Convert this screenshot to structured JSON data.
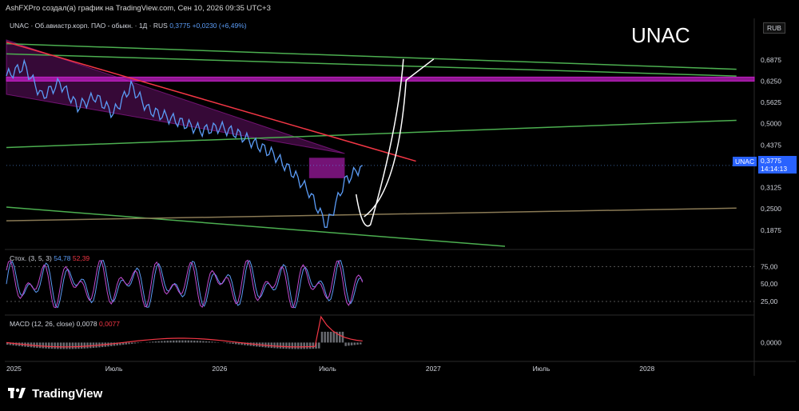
{
  "header": {
    "author_line": "AshFXPro создал(а) график на TradingView.com, Сен 10, 2026 09:35 UTC+3"
  },
  "legend": {
    "symbol_desc": "UNAC · Об.авиастр.корп. ПАО - обыкн. · 1Д · RUS",
    "last_value": "0,3775",
    "change": "+0,0230 (+6,49%)"
  },
  "big_ticker": "UNAC",
  "currency": "RUB",
  "price_tag": {
    "ticker": "UNAC",
    "value": "0,3775",
    "countdown": "14:14:13"
  },
  "stoch": {
    "label": "Стох. (3, 5, 3)",
    "k": "54,78",
    "d": "52,39"
  },
  "macd": {
    "label": "MACD (12, 26, close)",
    "macd": "0,0078",
    "signal": "0,0077"
  },
  "footer": {
    "brand": "TradingView"
  },
  "colors": {
    "price_line": "#5b9cf6",
    "trend_green": "#4caf50",
    "trend_red": "#f23645",
    "zone_magenta": "#c21fc4",
    "projection": "#ffffff",
    "stoch_k": "#5b9cf6",
    "stoch_d": "#c24bd1"
  },
  "chart_data": [
    {
      "type": "line",
      "title": "",
      "xlabel": "",
      "ylabel": "",
      "ylim": [
        0.14,
        0.76
      ],
      "x_ticks": [
        "2025",
        "Июль",
        "2026",
        "Июль",
        "2027",
        "Июль",
        "2028"
      ],
      "y_ticks": [
        "0,6875",
        "0,6250",
        "0,5625",
        "0,5000",
        "0,4375",
        "0,3125",
        "0,2500",
        "0,1875"
      ],
      "series": [
        {
          "x": [
            "2025-01",
            "2025-02",
            "2025-03",
            "2025-04",
            "2025-05",
            "2025-06",
            "2025-07",
            "2025-08",
            "2025-09",
            "2025-10",
            "2025-11",
            "2025-12",
            "2026-01",
            "2026-02",
            "2026-03",
            "2026-04",
            "2026-05",
            "2026-06",
            "2026-07",
            "2026-08",
            "2026-09"
          ],
          "values": [
            0.64,
            0.67,
            0.58,
            0.62,
            0.55,
            0.58,
            0.53,
            0.61,
            0.54,
            0.52,
            0.5,
            0.48,
            0.49,
            0.47,
            0.44,
            0.41,
            0.36,
            0.3,
            0.2,
            0.33,
            0.3775
          ]
        }
      ],
      "last_price": 0.3775,
      "zones": [
        {
          "name": "resistance-zone",
          "y_from": 0.625,
          "y_to": 0.637
        },
        {
          "name": "consolidation-box",
          "y_from": 0.34,
          "y_to": 0.4
        }
      ],
      "trendlines": [
        {
          "name": "green-upper-channel-top",
          "from": [
            "2025-01",
            0.735
          ],
          "to": [
            "2028-06",
            0.66
          ]
        },
        {
          "name": "green-upper-channel-bottom",
          "from": [
            "2025-01",
            0.705
          ],
          "to": [
            "2028-06",
            0.64
          ]
        },
        {
          "name": "green-middle",
          "from": [
            "2025-01",
            0.43
          ],
          "to": [
            "2028-06",
            0.51
          ]
        },
        {
          "name": "green-lower",
          "from": [
            "2025-01",
            0.255
          ],
          "to": [
            "2027-05",
            0.14
          ]
        },
        {
          "name": "red-downtrend",
          "from": [
            "2025-01",
            0.74
          ],
          "to": [
            "2026-12",
            0.39
          ]
        },
        {
          "name": "tan-baseline",
          "from": [
            "2025-01",
            0.215
          ],
          "to": [
            "2028-06",
            0.252
          ]
        }
      ],
      "projection": [
        [
          "2026-09",
          0.18
        ],
        [
          "2026-11",
          0.44
        ],
        [
          "2027-01",
          0.69
        ]
      ]
    },
    {
      "type": "line",
      "title": "Стох. (3, 5, 3)",
      "ylim": [
        10,
        95
      ],
      "y_ticks": [
        "75,00",
        "50,00",
        "25,00"
      ],
      "series": [
        {
          "name": "K",
          "x": [
            "2025-01",
            "2025-04",
            "2025-07",
            "2025-10",
            "2026-01",
            "2026-04",
            "2026-07",
            "2026-09"
          ],
          "values": [
            30,
            75,
            20,
            85,
            25,
            70,
            92,
            54.78
          ]
        },
        {
          "name": "D",
          "x": [
            "2025-01",
            "2025-04",
            "2025-07",
            "2025-10",
            "2026-01",
            "2026-04",
            "2026-07",
            "2026-09"
          ],
          "values": [
            35,
            70,
            25,
            80,
            30,
            65,
            88,
            52.39
          ]
        }
      ]
    },
    {
      "type": "bar",
      "title": "MACD (12, 26, close)",
      "ylim": [
        -0.08,
        0.12
      ],
      "y_ticks": [
        "0,0000"
      ],
      "macd": 0.0078,
      "signal": 0.0077
    }
  ]
}
